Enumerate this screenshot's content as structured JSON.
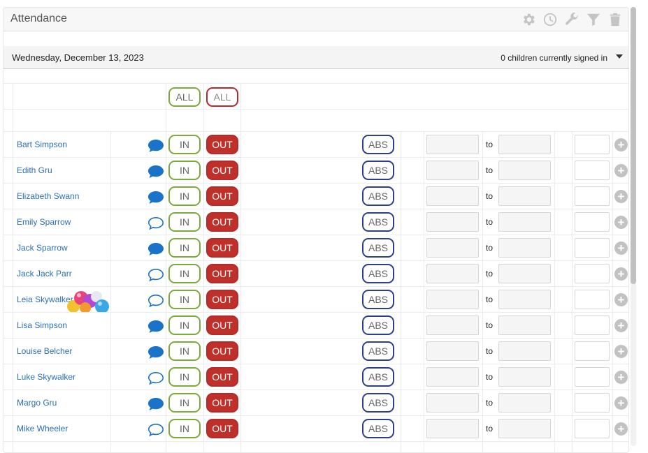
{
  "panel": {
    "title": "Attendance",
    "tools": [
      "gear-icon",
      "clock-icon",
      "wrench-icon",
      "filter-icon",
      "trash-icon"
    ]
  },
  "date_bar": {
    "date": "Wednesday, December 13, 2023",
    "signed_in": "0 children currently signed in"
  },
  "header": {
    "in_all": "ALL",
    "out_all": "ALL"
  },
  "labels": {
    "in": "IN",
    "out": "OUT",
    "abs": "ABS",
    "to": "to",
    "plus": "+"
  },
  "children": [
    {
      "name": "Bart Simpson",
      "note": "filled"
    },
    {
      "name": "Edith Gru",
      "note": "filled"
    },
    {
      "name": "Elizabeth Swann",
      "note": "filled"
    },
    {
      "name": "Emily Sparrow",
      "note": "outline"
    },
    {
      "name": "Jack Sparrow",
      "note": "filled"
    },
    {
      "name": "Jack Jack Parr",
      "note": "outline"
    },
    {
      "name": "Leia Skywalker",
      "note": "outline",
      "birthday": true
    },
    {
      "name": "Lisa Simpson",
      "note": "filled"
    },
    {
      "name": "Louise Belcher",
      "note": "filled"
    },
    {
      "name": "Luke Skywalker",
      "note": "outline"
    },
    {
      "name": "Margo Gru",
      "note": "filled"
    },
    {
      "name": "Mike Wheeler",
      "note": "outline"
    }
  ],
  "colors": {
    "in_border": "#7bab3a",
    "out_fill": "#c0302b",
    "abs_border": "#2c3f8c",
    "name_link": "#2a6ebb",
    "chat_icon": "#1a73c9"
  }
}
